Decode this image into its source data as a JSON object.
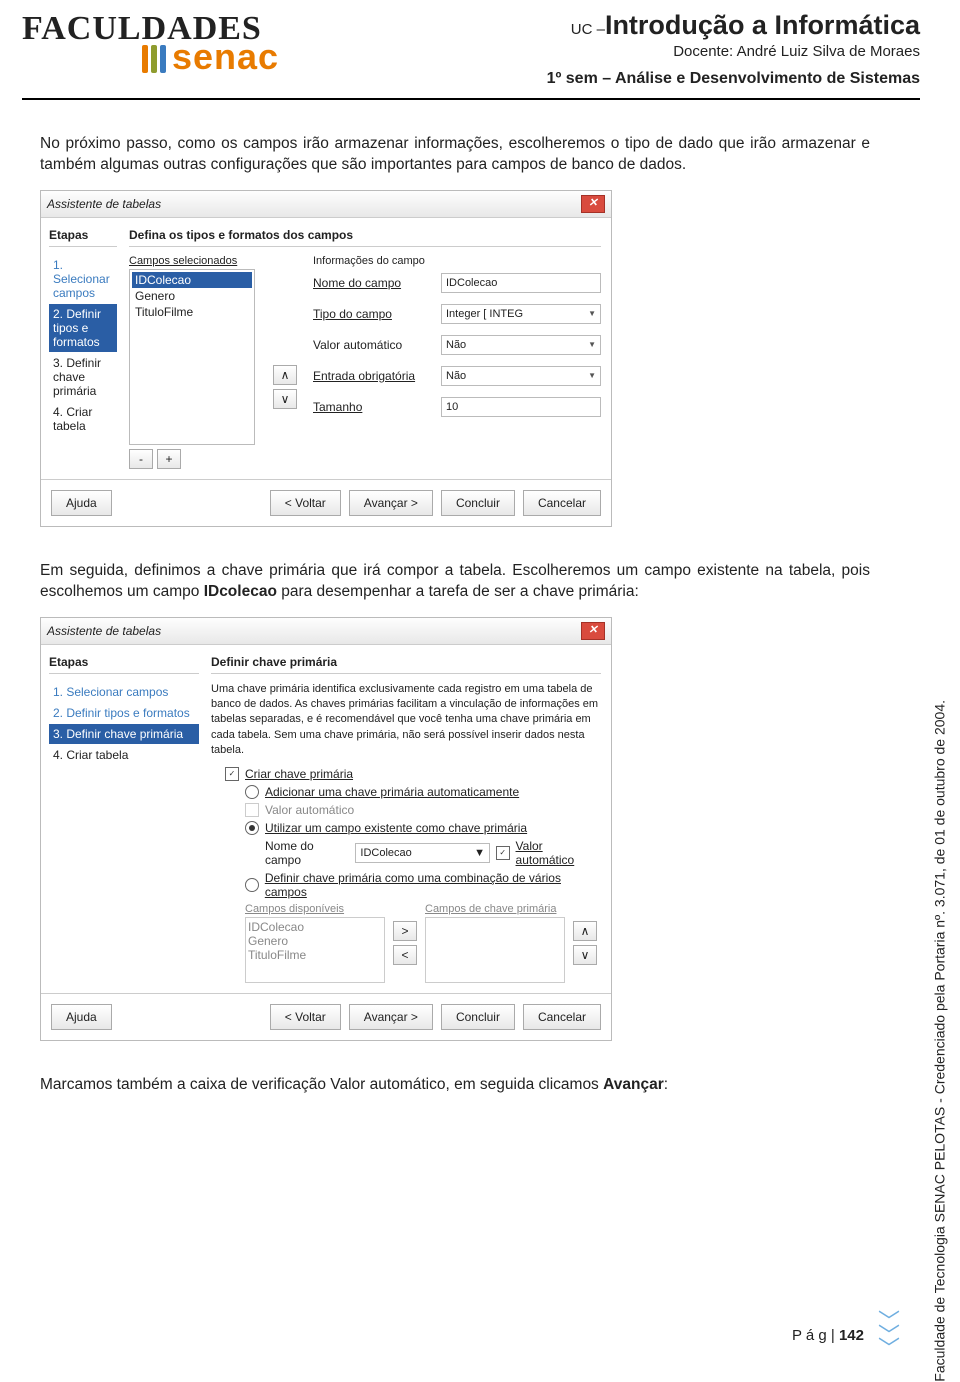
{
  "header": {
    "logo_text1": "FACULDADES",
    "logo_text2": "senac",
    "uc_prefix": "UC –",
    "uc_title": "Introdução a Informática",
    "docente": "Docente: André Luiz Silva de Moraes",
    "semestre": "1º sem – Análise e Desenvolvimento de Sistemas"
  },
  "para1": "No próximo passo, como os campos irão armazenar informações, escolheremos o tipo de dado que irão armazenar e também algumas outras configurações que são importantes para campos de banco de dados.",
  "wiz1": {
    "title": "Assistente de tabelas",
    "steps_title": "Etapas",
    "steps": [
      "1. Selecionar campos",
      "2. Definir tipos e formatos",
      "3. Definir chave primária",
      "4. Criar tabela"
    ],
    "active_step_index": 1,
    "main_title": "Defina os tipos e formatos dos campos",
    "selected_fields_label": "Campos selecionados",
    "selected_fields": [
      "IDColecao",
      "Genero",
      "TituloFilme"
    ],
    "highlight_field_index": 0,
    "info_title": "Informações do campo",
    "rows": {
      "nome_lbl": "Nome do campo",
      "nome_val": "IDColecao",
      "tipo_lbl": "Tipo do campo",
      "tipo_val": "Integer [ INTEG",
      "auto_lbl": "Valor automático",
      "auto_val": "Não",
      "req_lbl": "Entrada obrigatória",
      "req_val": "Não",
      "size_lbl": "Tamanho",
      "size_val": "10"
    },
    "btns": {
      "ajuda": "Ajuda",
      "voltar": "< Voltar",
      "avancar": "Avançar >",
      "concluir": "Concluir",
      "cancelar": "Cancelar"
    },
    "minus": "-",
    "plus": "+",
    "up": "∧",
    "down": "∨"
  },
  "para2_a": "Em seguida, definimos a chave primária que irá compor a tabela. Escolheremos um campo existente na tabela, pois escolhemos um campo ",
  "para2_b_bold": "IDcolecao",
  "para2_c": " para desempenhar a tarefa de ser a chave primária:",
  "wiz2": {
    "title": "Assistente de tabelas",
    "steps_title": "Etapas",
    "steps": [
      "1. Selecionar campos",
      "2. Definir tipos e formatos",
      "3. Definir chave primária",
      "4. Criar tabela"
    ],
    "active_step_index": 2,
    "main_title": "Definir chave primária",
    "desc": "Uma chave primária identifica exclusivamente cada registro em uma tabela de banco de dados. As chaves primárias facilitam a vinculação de informações em tabelas separadas, e é recomendável que você tenha uma chave primária em cada tabela. Sem uma chave primária, não será possível inserir dados nesta tabela.",
    "create_pk_label": "Criar chave primária",
    "opt1": "Adicionar uma chave primária automaticamente",
    "opt1_sub": "Valor automático",
    "opt2": "Utilizar um campo existente como chave primária",
    "opt2_field_lbl": "Nome do campo",
    "opt2_field_val": "IDColecao",
    "opt2_auto": "Valor automático",
    "opt3": "Definir chave primária como uma combinação de vários campos",
    "avail_label": "Campos disponíveis",
    "avail_fields": [
      "IDColecao",
      "Genero",
      "TituloFilme"
    ],
    "pk_label": "Campos de chave primária",
    "btns": {
      "ajuda": "Ajuda",
      "voltar": "< Voltar",
      "avancar": "Avançar >",
      "concluir": "Concluir",
      "cancelar": "Cancelar"
    },
    "move_right": ">",
    "move_left": "<",
    "up": "∧",
    "down": "∨"
  },
  "para3_a": "Marcamos também a caixa de verificação Valor automático, em seguida clicamos ",
  "para3_b_bold": "Avançar",
  "para3_c": ":",
  "side_text": "Faculdade de Tecnologia SENAC PELOTAS - Credenciado pela Portaria nº. 3.071, de 01 de outubro de 2004.",
  "footer": {
    "page_prefix": "P á g | ",
    "page_num": "142"
  }
}
